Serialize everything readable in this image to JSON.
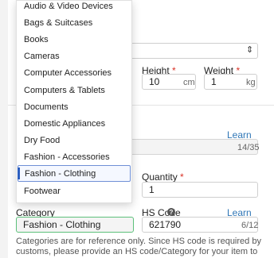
{
  "dimensions": {
    "height_label": "Height",
    "height_value": "10",
    "height_unit": "cm",
    "weight_label": "Weight",
    "weight_value": "1",
    "weight_unit": "kg",
    "required_mark": "*"
  },
  "description": {
    "learn_more": "Learn More",
    "counter": "14/35"
  },
  "quantity": {
    "label": "Quantity",
    "value": "1"
  },
  "category": {
    "label": "Category",
    "value": "Fashion - Clothing"
  },
  "hs_code": {
    "label": "HS Code",
    "help": "?",
    "learn_more": "Learn More",
    "value": "621790",
    "counter": "6/12"
  },
  "note": "Categories are for reference only. Since HS code is required by customs, please provide an HS code/Category for your item to avoid customs detention and extra tax.",
  "dropdown": {
    "selected_index": 10,
    "options": [
      "Audio & Video Devices",
      "Bags & Suitcases",
      "Books",
      "Cameras",
      "Computer Accessories",
      "Computers & Tablets",
      "Documents",
      "Domestic Appliances",
      "Dry Food",
      "Fashion - Accessories",
      "Fashion - Clothing",
      "Footwear"
    ]
  },
  "colors": {
    "link": "#2f76b6",
    "required": "#d93025",
    "category_border": "#5cc07a",
    "selected_border": "#6f8fd6"
  }
}
